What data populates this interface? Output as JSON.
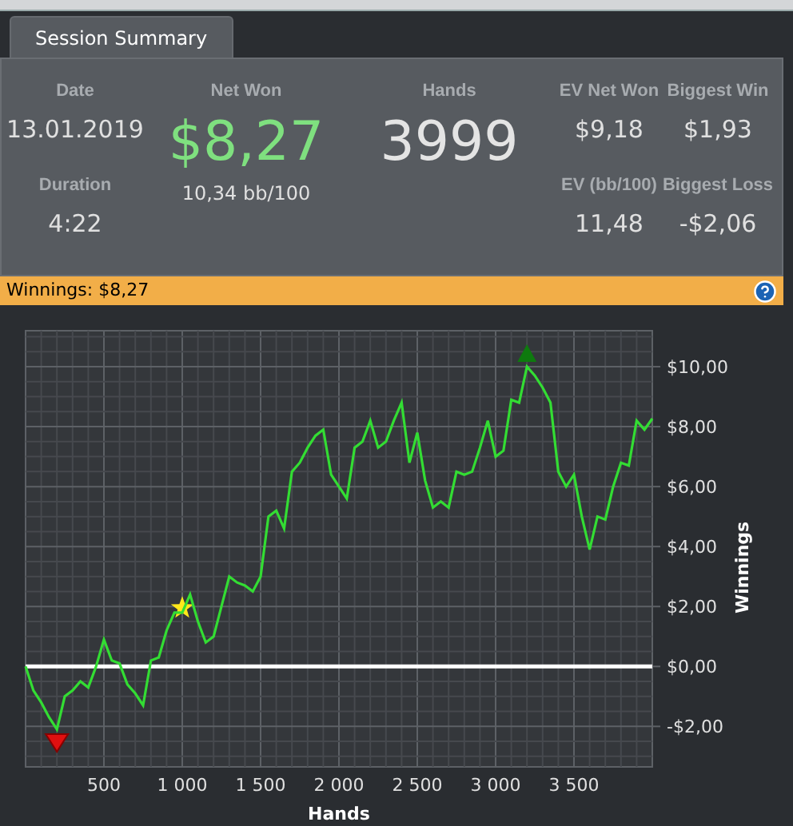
{
  "tabs": [
    {
      "label": "Session Summary",
      "selected": true
    }
  ],
  "stats": [
    {
      "label": "Date",
      "value": "13.01.2019",
      "kind": "plain"
    },
    {
      "label": "Net Won",
      "value": "$8,27",
      "sub": "10,34 bb/100",
      "kind": "big_green"
    },
    {
      "label": "Hands",
      "value": "3999",
      "kind": "big"
    },
    {
      "label": "EV Net Won",
      "value": "$9,18",
      "kind": "plain"
    },
    {
      "label": "Biggest Win",
      "value": "$1,93",
      "kind": "plain"
    },
    {
      "label": "Duration",
      "value": "4:22",
      "kind": "plain"
    },
    {
      "label": "EV (bb/100)",
      "value": "11,48",
      "kind": "plain"
    },
    {
      "label": "Biggest Loss",
      "value": "-$2,06",
      "kind": "plain"
    }
  ],
  "winnings_bar": {
    "label": "Winnings: $8,27"
  },
  "chart": {
    "chart_data": {
      "type": "line",
      "xlabel": "Hands",
      "ylabel": "Winnings",
      "xlim": [
        0,
        4000
      ],
      "ylim": [
        -3.35,
        11.2
      ],
      "xticks": [
        {
          "value": 500,
          "label": "500"
        },
        {
          "value": 1000,
          "label": "1 000"
        },
        {
          "value": 1500,
          "label": "1 500"
        },
        {
          "value": 2000,
          "label": "2 000"
        },
        {
          "value": 2500,
          "label": "2 500"
        },
        {
          "value": 3000,
          "label": "3 000"
        },
        {
          "value": 3500,
          "label": "3 500"
        }
      ],
      "yticks": [
        {
          "value": -2,
          "label": "-$2,00"
        },
        {
          "value": 0,
          "label": "$0,00"
        },
        {
          "value": 2,
          "label": "$2,00"
        },
        {
          "value": 4,
          "label": "$4,00"
        },
        {
          "value": 6,
          "label": "$6,00"
        },
        {
          "value": 8,
          "label": "$8,00"
        },
        {
          "value": 10,
          "label": "$10,00"
        }
      ],
      "x": [
        0,
        50,
        100,
        150,
        200,
        250,
        300,
        350,
        400,
        450,
        500,
        550,
        600,
        650,
        700,
        750,
        800,
        850,
        900,
        950,
        1000,
        1050,
        1100,
        1150,
        1200,
        1250,
        1300,
        1350,
        1400,
        1450,
        1500,
        1550,
        1600,
        1650,
        1700,
        1750,
        1800,
        1850,
        1900,
        1950,
        2000,
        2050,
        2100,
        2150,
        2200,
        2250,
        2300,
        2350,
        2400,
        2450,
        2500,
        2550,
        2600,
        2650,
        2700,
        2750,
        2800,
        2850,
        2900,
        2950,
        3000,
        3050,
        3100,
        3150,
        3200,
        3250,
        3300,
        3350,
        3400,
        3450,
        3500,
        3550,
        3600,
        3650,
        3700,
        3750,
        3800,
        3850,
        3900,
        3950,
        4000
      ],
      "grid": true,
      "series": [
        {
          "color": "#33dd33",
          "values": [
            0,
            -0.8,
            -1.2,
            -1.7,
            -2.1,
            -1.0,
            -0.8,
            -0.5,
            -0.7,
            0.0,
            0.9,
            0.2,
            0.1,
            -0.6,
            -0.9,
            -1.3,
            0.2,
            0.3,
            1.2,
            1.8,
            1.8,
            2.4,
            1.5,
            0.8,
            1.0,
            2.0,
            3.0,
            2.8,
            2.7,
            2.5,
            3.0,
            5.0,
            5.2,
            4.6,
            6.5,
            6.8,
            7.3,
            7.7,
            7.9,
            6.4,
            6.0,
            5.6,
            7.3,
            7.5,
            8.2,
            7.3,
            7.5,
            8.2,
            8.8,
            6.8,
            7.8,
            6.2,
            5.3,
            5.5,
            5.3,
            6.5,
            6.4,
            6.5,
            7.3,
            8.2,
            7.0,
            7.2,
            8.9,
            8.8,
            10.0,
            9.7,
            9.3,
            8.8,
            6.5,
            6.0,
            6.4,
            5.0,
            3.9,
            5.0,
            4.9,
            6.0,
            6.8,
            6.7,
            8.2,
            7.9,
            8.27
          ]
        }
      ]
    }
  }
}
